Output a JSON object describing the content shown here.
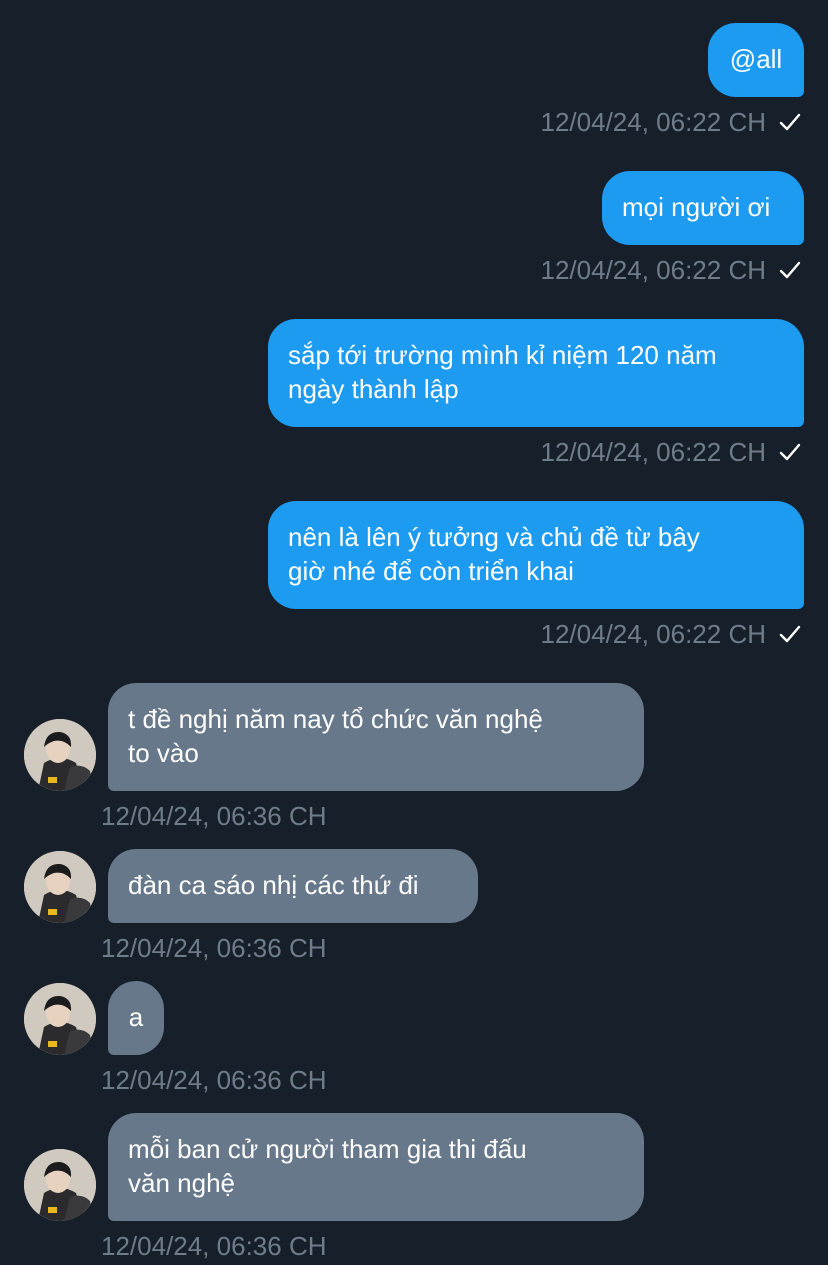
{
  "messages": {
    "m1": {
      "text": "@all",
      "time": "12/04/24, 06:22 CH"
    },
    "m2": {
      "text": "mọi người ơi",
      "time": "12/04/24, 06:22 CH"
    },
    "m3": {
      "text": "sắp tới trường mình kỉ niệm 120 năm\nngày thành lập",
      "time": "12/04/24, 06:22 CH"
    },
    "m4": {
      "text": "nên là lên ý tưởng và chủ đề từ bây\ngiờ nhé để còn triển khai",
      "time": "12/04/24, 06:22 CH"
    },
    "m5": {
      "text": "t đề nghị năm nay tổ chức văn nghệ\nto vào",
      "time": "12/04/24, 06:36 CH"
    },
    "m6": {
      "text": "đàn ca sáo nhị các thứ đi",
      "time": "12/04/24, 06:36 CH"
    },
    "m7": {
      "text": "a",
      "time": "12/04/24, 06:36 CH"
    },
    "m8": {
      "text": "mỗi ban cử người tham gia thi đấu\nvăn nghệ",
      "time": "12/04/24, 06:36 CH"
    }
  },
  "colors": {
    "background": "#17202a",
    "outgoing_bubble": "#1d9bf0",
    "incoming_bubble": "#66788a",
    "timestamp": "#6f7d8b"
  },
  "icons": {
    "sent_status": "checkmark-icon",
    "sender_avatar": "avatar"
  }
}
